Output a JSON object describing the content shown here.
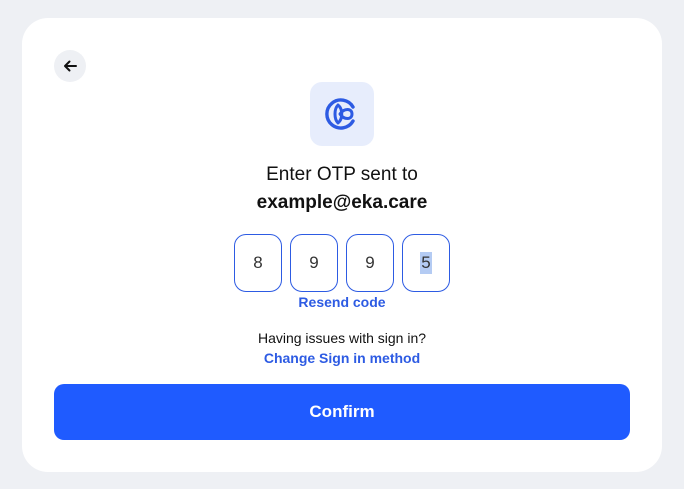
{
  "header": {
    "back_icon": "arrow-left-icon",
    "logo_icon": "eka-care-logo"
  },
  "main": {
    "heading": "Enter OTP sent to",
    "email": "example@eka.care",
    "otp_digits": [
      "8",
      "9",
      "9",
      "5"
    ],
    "resend_label": "Resend code",
    "issues_text": "Having issues with sign in?",
    "change_method_label": "Change Sign in method",
    "confirm_label": "Confirm"
  },
  "colors": {
    "accent": "#2d5be3",
    "button": "#1f5bff",
    "background": "#eef0f4",
    "card": "#ffffff"
  }
}
